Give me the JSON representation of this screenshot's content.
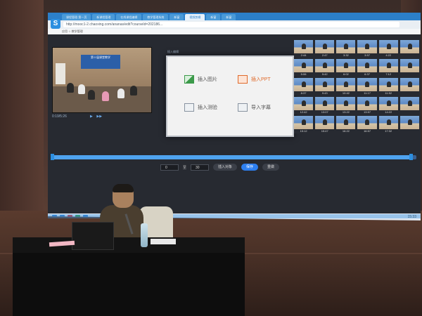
{
  "browser": {
    "tabs": [
      "课程管理-第一页",
      "新课程管理",
      "在线课程编辑",
      "教学管理系统",
      "新窗",
      "视频剪辑",
      "新窗",
      "新窗"
    ],
    "active_tab_index": 5,
    "url": "http://mooc1-2.chaoxing.com/ananas/edit?courseId=202186...",
    "bookmarks": "应用  ☆ 教学管理"
  },
  "player": {
    "video_banner": "第十届课堂教学",
    "time": "0:19/5:26",
    "play_label": "▶",
    "next_label": "▶▶"
  },
  "dialog": {
    "title": "插入编辑",
    "insert_image": "插入图片",
    "insert_ppt": "插入PPT",
    "insert_quiz": "插入测验",
    "insert_subtitle": "导入字幕"
  },
  "thumbnails": [
    {
      "caption": "2:44"
    },
    {
      "caption": "2:47"
    },
    {
      "caption": "3:32"
    },
    {
      "caption": "3:57"
    },
    {
      "caption": "4:22"
    },
    {
      "caption": ""
    },
    {
      "caption": "5:06"
    },
    {
      "caption": "5:42"
    },
    {
      "caption": "6:02"
    },
    {
      "caption": "6:37"
    },
    {
      "caption": "7:12"
    },
    {
      "caption": ""
    },
    {
      "caption": "8:37"
    },
    {
      "caption": "9:43"
    },
    {
      "caption": "10:42"
    },
    {
      "caption": "11:17"
    },
    {
      "caption": "11:52"
    },
    {
      "caption": ""
    },
    {
      "caption": "12:42"
    },
    {
      "caption": "13:07"
    },
    {
      "caption": "13:22"
    },
    {
      "caption": "13:57"
    },
    {
      "caption": "14:22"
    },
    {
      "caption": ""
    },
    {
      "caption": "15:12"
    },
    {
      "caption": "15:47"
    },
    {
      "caption": "16:22"
    },
    {
      "caption": "16:57"
    },
    {
      "caption": "17:32"
    },
    {
      "caption": ""
    }
  ],
  "timeline": {
    "progress_fraction": 0.99
  },
  "controls": {
    "start_value": "0",
    "separator": "至",
    "end_value": "30",
    "insert_button": "插入对象",
    "save_button": "保存",
    "cancel_button": "重做"
  },
  "taskbar": {
    "time": "15:33"
  },
  "colors": {
    "accent_blue": "#2d8fe0",
    "primary_button": "#2d7ff0",
    "ppt_orange": "#e06a2a",
    "image_green": "#3c9a4a"
  }
}
